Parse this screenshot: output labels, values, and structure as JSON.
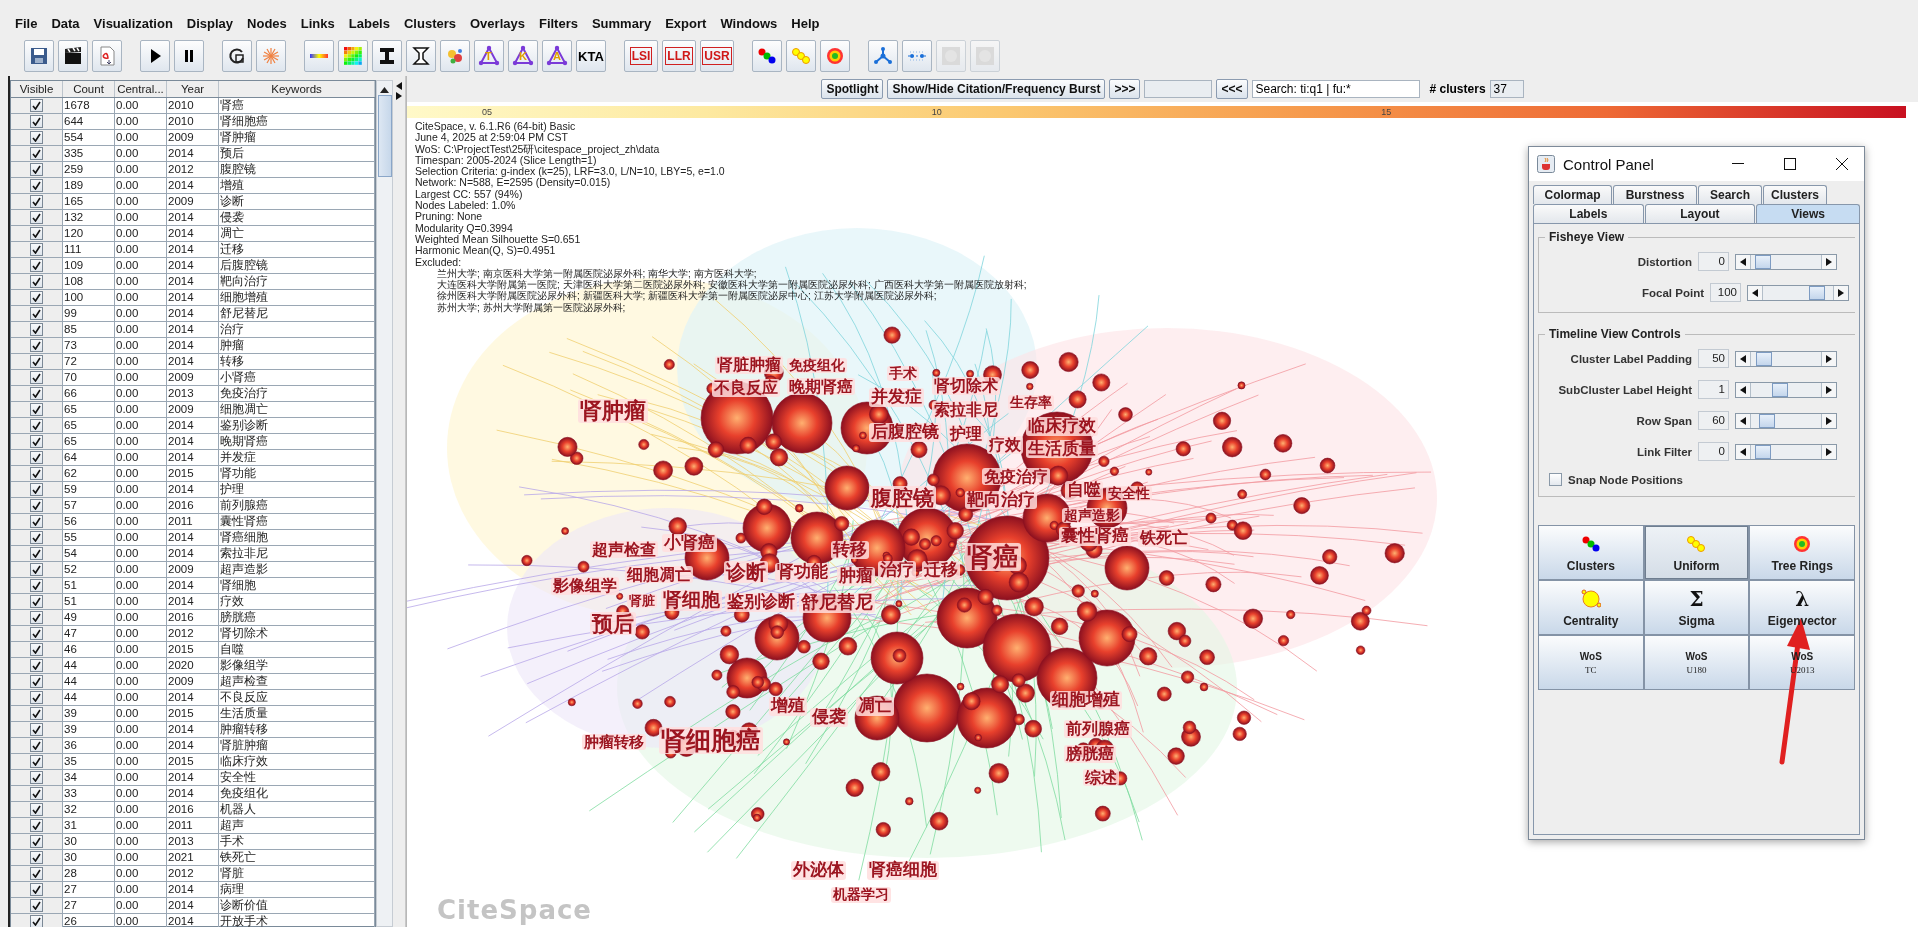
{
  "menu": [
    "File",
    "Data",
    "Visualization",
    "Display",
    "Nodes",
    "Links",
    "Labels",
    "Clusters",
    "Overlays",
    "Filters",
    "Summary",
    "Export",
    "Windows",
    "Help"
  ],
  "toolbar_tools": [
    {
      "kind": "triangle",
      "label": "T"
    },
    {
      "kind": "triangle",
      "label": "K"
    },
    {
      "kind": "triangle",
      "label": "A"
    },
    {
      "kind": "text",
      "label": "KTA"
    },
    {
      "kind": "boxed",
      "label": "LSI"
    },
    {
      "kind": "boxed",
      "label": "LLR"
    },
    {
      "kind": "boxed",
      "label": "USR"
    }
  ],
  "keyword_table": {
    "columns": [
      "Visible",
      "Count",
      "Central...",
      "Year",
      "Keywords"
    ],
    "rows": [
      {
        "visible": true,
        "count": "1678",
        "centrality": "0.00",
        "year": "2010",
        "keyword": "肾癌"
      },
      {
        "visible": true,
        "count": "644",
        "centrality": "0.00",
        "year": "2010",
        "keyword": "肾细胞癌"
      },
      {
        "visible": true,
        "count": "554",
        "centrality": "0.00",
        "year": "2009",
        "keyword": "肾肿瘤"
      },
      {
        "visible": true,
        "count": "335",
        "centrality": "0.00",
        "year": "2014",
        "keyword": "预后"
      },
      {
        "visible": true,
        "count": "259",
        "centrality": "0.00",
        "year": "2012",
        "keyword": "腹腔镜"
      },
      {
        "visible": true,
        "count": "189",
        "centrality": "0.00",
        "year": "2014",
        "keyword": "增殖"
      },
      {
        "visible": true,
        "count": "165",
        "centrality": "0.00",
        "year": "2009",
        "keyword": "诊断"
      },
      {
        "visible": true,
        "count": "132",
        "centrality": "0.00",
        "year": "2014",
        "keyword": "侵袭"
      },
      {
        "visible": true,
        "count": "120",
        "centrality": "0.00",
        "year": "2014",
        "keyword": "凋亡"
      },
      {
        "visible": true,
        "count": "111",
        "centrality": "0.00",
        "year": "2014",
        "keyword": "迁移"
      },
      {
        "visible": true,
        "count": "109",
        "centrality": "0.00",
        "year": "2014",
        "keyword": "后腹腔镜"
      },
      {
        "visible": true,
        "count": "108",
        "centrality": "0.00",
        "year": "2014",
        "keyword": "靶向治疗"
      },
      {
        "visible": true,
        "count": "100",
        "centrality": "0.00",
        "year": "2014",
        "keyword": "细胞增殖"
      },
      {
        "visible": true,
        "count": "99",
        "centrality": "0.00",
        "year": "2014",
        "keyword": "舒尼替尼"
      },
      {
        "visible": true,
        "count": "85",
        "centrality": "0.00",
        "year": "2014",
        "keyword": "治疗"
      },
      {
        "visible": true,
        "count": "73",
        "centrality": "0.00",
        "year": "2014",
        "keyword": "肿瘤"
      },
      {
        "visible": true,
        "count": "72",
        "centrality": "0.00",
        "year": "2014",
        "keyword": "转移"
      },
      {
        "visible": true,
        "count": "70",
        "centrality": "0.00",
        "year": "2009",
        "keyword": "小肾癌"
      },
      {
        "visible": true,
        "count": "66",
        "centrality": "0.00",
        "year": "2013",
        "keyword": "免疫治疗"
      },
      {
        "visible": true,
        "count": "65",
        "centrality": "0.00",
        "year": "2009",
        "keyword": "细胞凋亡"
      },
      {
        "visible": true,
        "count": "65",
        "centrality": "0.00",
        "year": "2014",
        "keyword": "鉴别诊断"
      },
      {
        "visible": true,
        "count": "65",
        "centrality": "0.00",
        "year": "2014",
        "keyword": "晚期肾癌"
      },
      {
        "visible": true,
        "count": "64",
        "centrality": "0.00",
        "year": "2014",
        "keyword": "并发症"
      },
      {
        "visible": true,
        "count": "62",
        "centrality": "0.00",
        "year": "2015",
        "keyword": "肾功能"
      },
      {
        "visible": true,
        "count": "59",
        "centrality": "0.00",
        "year": "2014",
        "keyword": "护理"
      },
      {
        "visible": true,
        "count": "57",
        "centrality": "0.00",
        "year": "2016",
        "keyword": "前列腺癌"
      },
      {
        "visible": true,
        "count": "56",
        "centrality": "0.00",
        "year": "2011",
        "keyword": "囊性肾癌"
      },
      {
        "visible": true,
        "count": "55",
        "centrality": "0.00",
        "year": "2014",
        "keyword": "肾癌细胞"
      },
      {
        "visible": true,
        "count": "54",
        "centrality": "0.00",
        "year": "2014",
        "keyword": "索拉非尼"
      },
      {
        "visible": true,
        "count": "52",
        "centrality": "0.00",
        "year": "2009",
        "keyword": "超声造影"
      },
      {
        "visible": true,
        "count": "51",
        "centrality": "0.00",
        "year": "2014",
        "keyword": "肾细胞"
      },
      {
        "visible": true,
        "count": "51",
        "centrality": "0.00",
        "year": "2014",
        "keyword": "疗效"
      },
      {
        "visible": true,
        "count": "49",
        "centrality": "0.00",
        "year": "2016",
        "keyword": "膀胱癌"
      },
      {
        "visible": true,
        "count": "47",
        "centrality": "0.00",
        "year": "2012",
        "keyword": "肾切除术"
      },
      {
        "visible": true,
        "count": "46",
        "centrality": "0.00",
        "year": "2015",
        "keyword": "自噬"
      },
      {
        "visible": true,
        "count": "44",
        "centrality": "0.00",
        "year": "2020",
        "keyword": "影像组学"
      },
      {
        "visible": true,
        "count": "44",
        "centrality": "0.00",
        "year": "2009",
        "keyword": "超声检查"
      },
      {
        "visible": true,
        "count": "44",
        "centrality": "0.00",
        "year": "2014",
        "keyword": "不良反应"
      },
      {
        "visible": true,
        "count": "39",
        "centrality": "0.00",
        "year": "2015",
        "keyword": "生活质量"
      },
      {
        "visible": true,
        "count": "39",
        "centrality": "0.00",
        "year": "2014",
        "keyword": "肿瘤转移"
      },
      {
        "visible": true,
        "count": "36",
        "centrality": "0.00",
        "year": "2014",
        "keyword": "肾脏肿瘤"
      },
      {
        "visible": true,
        "count": "35",
        "centrality": "0.00",
        "year": "2015",
        "keyword": "临床疗效"
      },
      {
        "visible": true,
        "count": "34",
        "centrality": "0.00",
        "year": "2014",
        "keyword": "安全性"
      },
      {
        "visible": true,
        "count": "33",
        "centrality": "0.00",
        "year": "2014",
        "keyword": "免疫组化"
      },
      {
        "visible": true,
        "count": "32",
        "centrality": "0.00",
        "year": "2016",
        "keyword": "机器人"
      },
      {
        "visible": true,
        "count": "31",
        "centrality": "0.00",
        "year": "2011",
        "keyword": "超声"
      },
      {
        "visible": true,
        "count": "30",
        "centrality": "0.00",
        "year": "2013",
        "keyword": "手术"
      },
      {
        "visible": true,
        "count": "30",
        "centrality": "0.00",
        "year": "2021",
        "keyword": "铁死亡"
      },
      {
        "visible": true,
        "count": "28",
        "centrality": "0.00",
        "year": "2012",
        "keyword": "肾脏"
      },
      {
        "visible": true,
        "count": "27",
        "centrality": "0.00",
        "year": "2014",
        "keyword": "病理"
      },
      {
        "visible": true,
        "count": "27",
        "centrality": "0.00",
        "year": "2014",
        "keyword": "诊断价值"
      },
      {
        "visible": true,
        "count": "26",
        "centrality": "0.00",
        "year": "2014",
        "keyword": "开放手术"
      }
    ]
  },
  "view_toolbar": {
    "spotlight": "Spotlight",
    "burst": "Show/Hide Citation/Frequency Burst",
    "next": ">>>",
    "prev": "<<<",
    "search_value": "Search: ti:q1 | fu:*",
    "clusters_label": "# clusters",
    "clusters_value": "37"
  },
  "color_bar_ticks": [
    "05",
    "10",
    "15"
  ],
  "summary": [
    "CiteSpace, v. 6.1.R6 (64-bit) Basic",
    "June 4, 2025 at 2:59:04 PM CST",
    "WoS: C:\\ProjectTest\\25研\\citespace_project_zh\\data",
    "Timespan: 2005-2024 (Slice Length=1)",
    "Selection Criteria: g-index (k=25), LRF=3.0, L/N=10, LBY=5, e=1.0",
    "Network: N=588, E=2595 (Density=0.015)",
    "Largest CC: 557 (94%)",
    "Nodes Labeled: 1.0%",
    "Pruning: None",
    "Modularity Q=0.3994",
    "Weighted Mean Silhouette S=0.651",
    "Harmonic Mean(Q, S)=0.4951",
    "Excluded:"
  ],
  "excluded": [
    "兰州大学; 南京医科大学第一附属医院泌尿外科; 南华大学; 南方医科大学;",
    "大连医科大学附属第一医院; 天津医科大学第二医院泌尿外科; 安徽医科大学第一附属医院泌尿外科; 广西医科大学第一附属医院放射科;",
    "徐州医科大学附属医院泌尿外科; 新疆医科大学; 新疆医科大学第一附属医院泌尿中心; 江苏大学附属医院泌尿外科;",
    "苏州大学; 苏州大学附属第一医院泌尿外科;"
  ],
  "network_labels": [
    "肾脏肿瘤",
    "免疫组化",
    "手术",
    "不良反应",
    "晚期肾癌",
    "肾切除术",
    "肾肿瘤",
    "并发症",
    "索拉非尼",
    "生存率",
    "后腹腔镜",
    "护理",
    "疗效",
    "临床疗效",
    "生活质量",
    "免疫治疗",
    "腹腔镜",
    "靶向治疗",
    "自噬",
    "安全性",
    "超声造影",
    "超声检查",
    "小肾癌",
    "转移",
    "肾癌",
    "囊性肾癌",
    "铁死亡",
    "细胞凋亡",
    "诊断",
    "肾功能",
    "肿瘤",
    "治疗",
    "迁移",
    "影像组学",
    "肾脏",
    "肾细胞",
    "鉴别诊断",
    "舒尼替尼",
    "预后",
    "增殖",
    "侵袭",
    "凋亡",
    "细胞增殖",
    "前列腺癌",
    "肿瘤转移",
    "肾细胞癌",
    "膀胱癌",
    "综述",
    "外泌体",
    "肾癌细胞",
    "机器学习"
  ],
  "logo_text": "CiteSpace",
  "control_panel": {
    "title": "Control Panel",
    "button_glyphs": [
      "Σ",
      "λ"
    ],
    "tabs_row_1": [
      {
        "label": "Colormap",
        "selected": false
      },
      {
        "label": "Burstness",
        "selected": false
      },
      {
        "label": "Search",
        "selected": false
      },
      {
        "label": "Clusters",
        "selected": false
      }
    ],
    "tabs_row_2": [
      {
        "label": "Labels",
        "selected": false
      },
      {
        "label": "Layout",
        "selected": false
      },
      {
        "label": "Views",
        "selected": true
      }
    ],
    "groups": [
      {
        "title": "Fisheye View",
        "sliders": [
          {
            "label": "Distortion",
            "value": "0",
            "level": 0.08
          },
          {
            "label": "Focal Point",
            "value": "100",
            "level": 0.85
          }
        ]
      },
      {
        "title": "Timeline View Controls",
        "sliders": [
          {
            "label": "Cluster Label Padding",
            "value": "50",
            "level": 0.1
          },
          {
            "label": "SubCluster Label Height",
            "value": "1",
            "level": 0.38
          },
          {
            "label": "Row Span",
            "value": "60",
            "level": 0.15
          },
          {
            "label": "Link Filter",
            "value": "0",
            "level": 0.08
          }
        ],
        "checkbox": {
          "label": "Snap Node Positions",
          "checked": false
        }
      }
    ],
    "view_buttons": [
      {
        "kind": "clusters",
        "label": "Clusters",
        "selected": false
      },
      {
        "kind": "uniform",
        "label": "Uniform",
        "selected": true
      },
      {
        "kind": "tree-rings",
        "label": "Tree Rings",
        "selected": false
      },
      {
        "kind": "centrality",
        "label": "Centrality",
        "selected": false
      },
      {
        "kind": "glyph",
        "label": "Sigma",
        "selected": false
      },
      {
        "kind": "glyph",
        "label": "Eigenvector",
        "selected": false
      },
      {
        "kind": "wos",
        "label": "WoS",
        "sublabel": "TC",
        "selected": false
      },
      {
        "kind": "wos",
        "label": "WoS",
        "sublabel": "U180",
        "selected": false
      },
      {
        "kind": "wos",
        "label": "WoS",
        "sublabel": "U2013",
        "selected": false
      }
    ]
  }
}
